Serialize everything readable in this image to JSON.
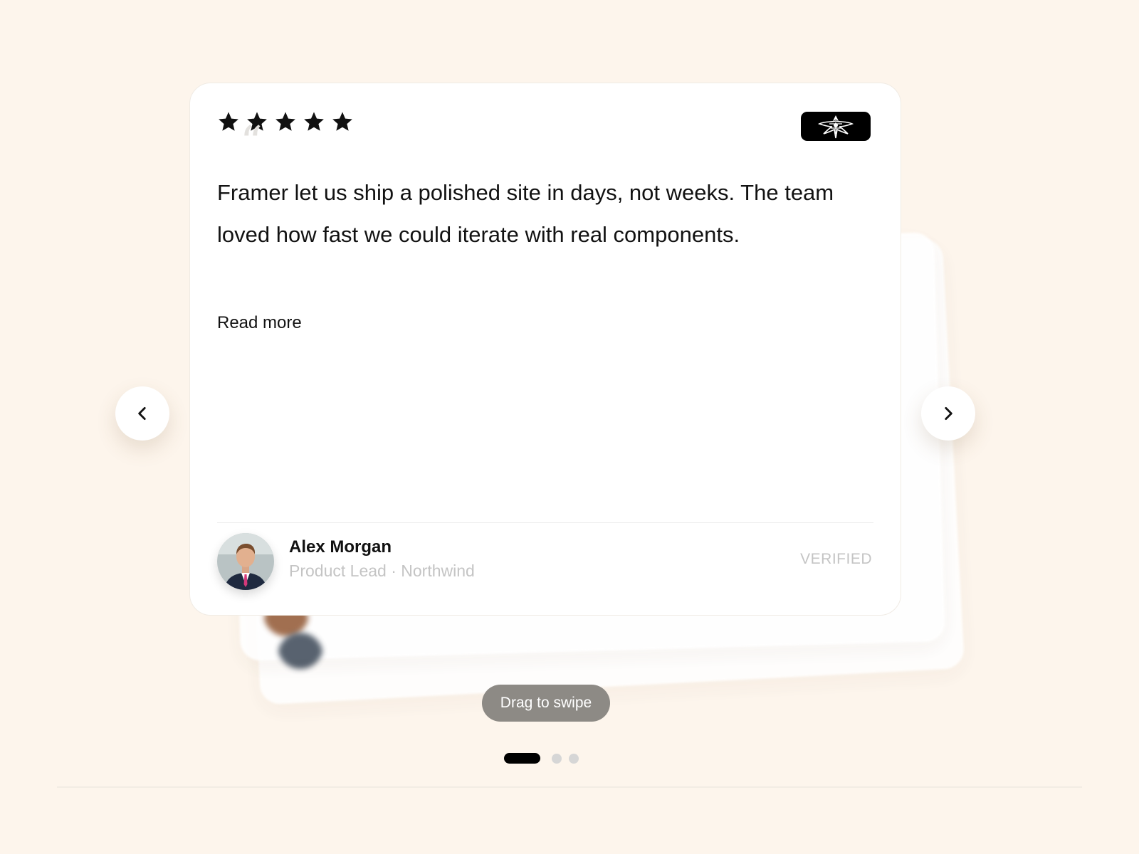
{
  "testimonial": {
    "rating": 5,
    "quote_mark": "“",
    "quote": "Framer let us ship a polished site in days, not weeks. The team loved how fast we could iterate with real components.",
    "read_more": "Read more",
    "author": {
      "name": "Alex Morgan",
      "role": "Product Lead · Northwind"
    },
    "verified": "VERIFIED",
    "logo_icon": "winged-emblem-icon"
  },
  "navigation": {
    "prev_icon": "chevron-left-icon",
    "next_icon": "chevron-right-icon"
  },
  "drag_hint": "Drag to swipe",
  "pagination": {
    "total": 3,
    "active_index": 0
  },
  "colors": {
    "background": "#fdf5ec",
    "card": "#ffffff",
    "text": "#121212",
    "muted": "#c4c4c4",
    "pill": "#8d8a85",
    "active_dot": "#000000",
    "inactive_dot": "#d6d6d6"
  }
}
